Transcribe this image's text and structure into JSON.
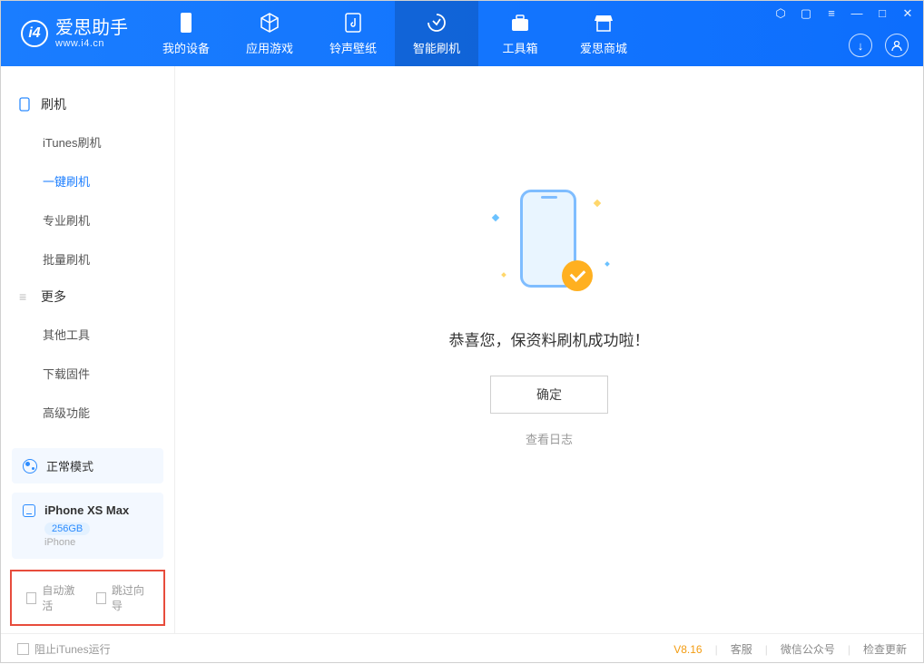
{
  "header": {
    "app_name": "爱思助手",
    "app_url": "www.i4.cn",
    "tabs": [
      {
        "label": "我的设备"
      },
      {
        "label": "应用游戏"
      },
      {
        "label": "铃声壁纸"
      },
      {
        "label": "智能刷机"
      },
      {
        "label": "工具箱"
      },
      {
        "label": "爱思商城"
      }
    ]
  },
  "sidebar": {
    "section1": {
      "title": "刷机",
      "items": [
        "iTunes刷机",
        "一键刷机",
        "专业刷机",
        "批量刷机"
      ]
    },
    "section2": {
      "title": "更多",
      "items": [
        "其他工具",
        "下载固件",
        "高级功能"
      ]
    },
    "mode": "正常模式",
    "device": {
      "name": "iPhone XS Max",
      "capacity": "256GB",
      "type": "iPhone"
    },
    "options": {
      "auto_activate": "自动激活",
      "skip_guide": "跳过向导"
    }
  },
  "main": {
    "message": "恭喜您，保资料刷机成功啦！",
    "ok": "确定",
    "view_log": "查看日志"
  },
  "footer": {
    "block_itunes": "阻止iTunes运行",
    "version": "V8.16",
    "links": [
      "客服",
      "微信公众号",
      "检查更新"
    ]
  }
}
